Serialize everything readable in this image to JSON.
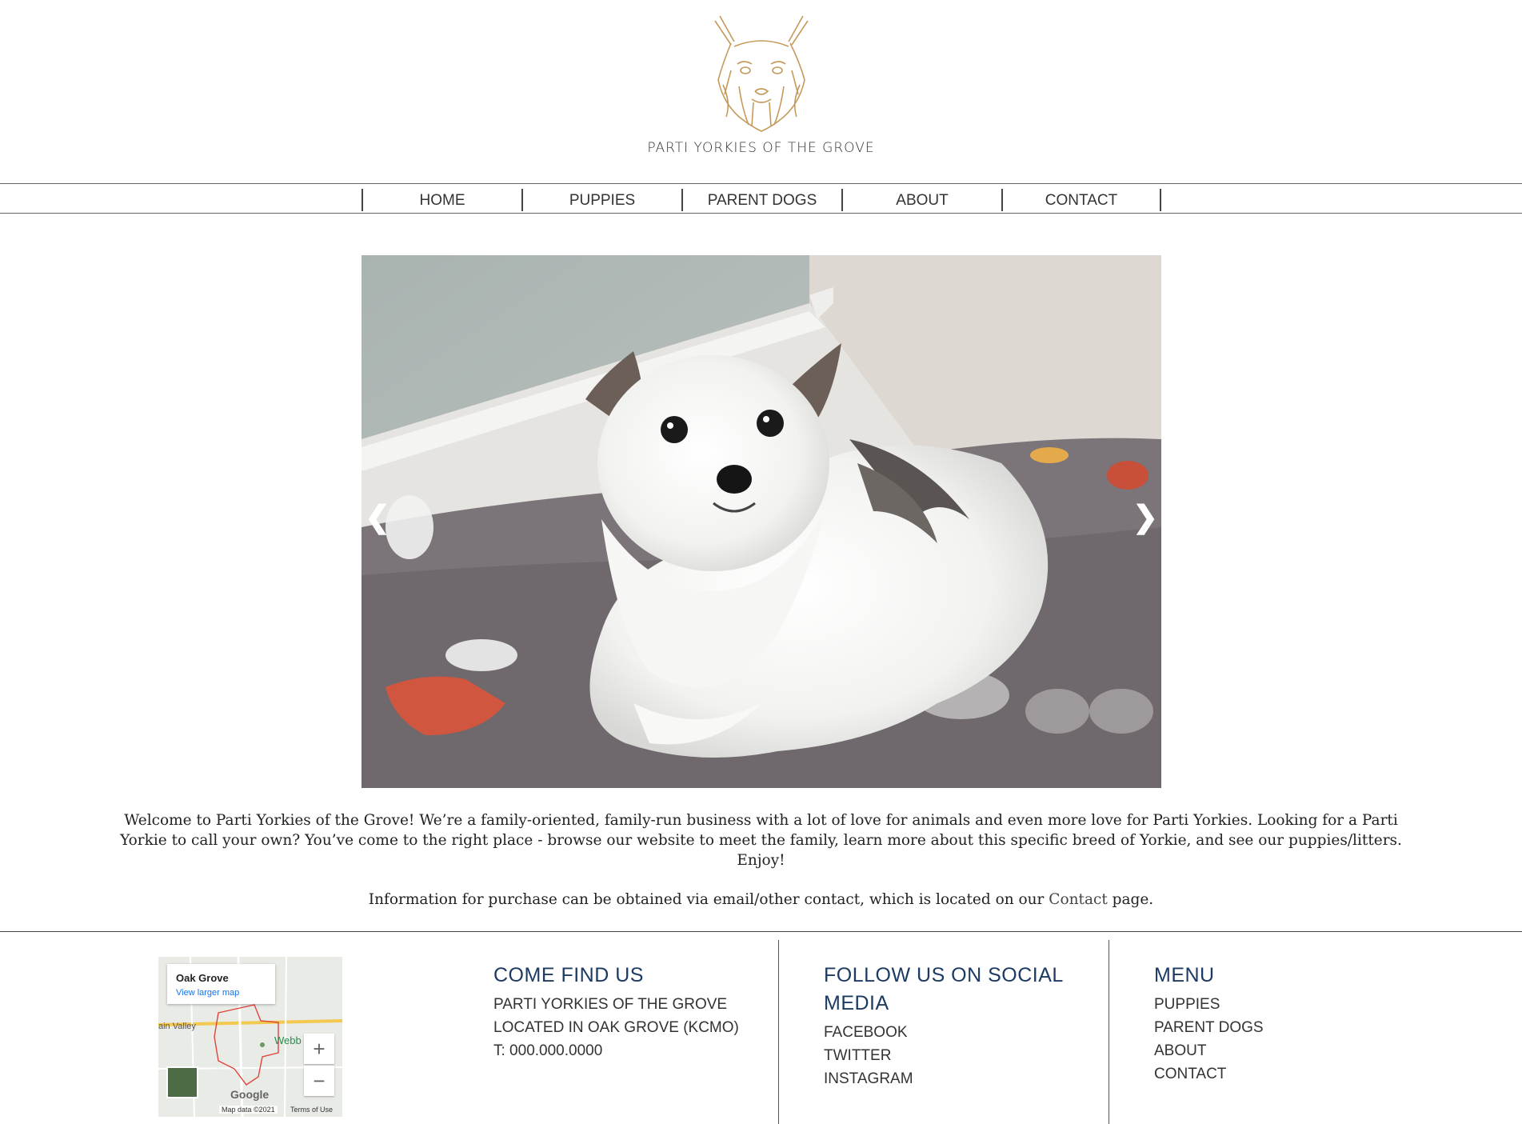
{
  "brand": {
    "name": "PARTI YORKIES OF THE GROVE",
    "logo_icon": "yorkie-head-sketch-icon"
  },
  "nav": {
    "items": [
      {
        "label": "HOME"
      },
      {
        "label": "PUPPIES"
      },
      {
        "label": "PARENT DOGS"
      },
      {
        "label": "ABOUT"
      },
      {
        "label": "CONTACT"
      }
    ]
  },
  "slider": {
    "prev": "❮",
    "next": "❯"
  },
  "intro": {
    "welcome": "Welcome to Parti Yorkies of the Grove! We’re a family-oriented, family-run business with a lot of love for animals and even more love for Parti Yorkies. Looking for a Parti Yorkie to call your own? You’ve come to the right place - browse our website to meet the family, learn more about this specific breed of Yorkie, and see our puppies/litters. Enjoy!",
    "purchase_before": "Information for purchase can be obtained via email/other contact, which is located on our ",
    "contact_link": "Contact",
    "purchase_after": " page."
  },
  "map": {
    "place": "Oak Grove",
    "view_larger": "View larger map",
    "town_label": "ain Valley",
    "webb_label": "Webb",
    "zoom_in": "+",
    "zoom_out": "−",
    "google": "Google",
    "map_data": "Map data ©2021",
    "terms": "Terms of Use"
  },
  "footer": {
    "find": {
      "heading": "COME FIND US",
      "lines": [
        "PARTI YORKIES OF THE GROVE",
        "LOCATED IN OAK GROVE (KCMO)",
        "T: 000.000.0000"
      ]
    },
    "social": {
      "heading_line1": "FOLLOW US ON SOCIAL",
      "heading_line2": "MEDIA",
      "links": [
        "FACEBOOK",
        "TWITTER",
        "INSTAGRAM"
      ]
    },
    "menu": {
      "heading": "MENU",
      "links": [
        "PUPPIES",
        "PARENT DOGS",
        "ABOUT",
        "CONTACT"
      ]
    }
  },
  "colors": {
    "accent_gold": "#c49a5a",
    "heading_navy": "#1c3b63"
  }
}
